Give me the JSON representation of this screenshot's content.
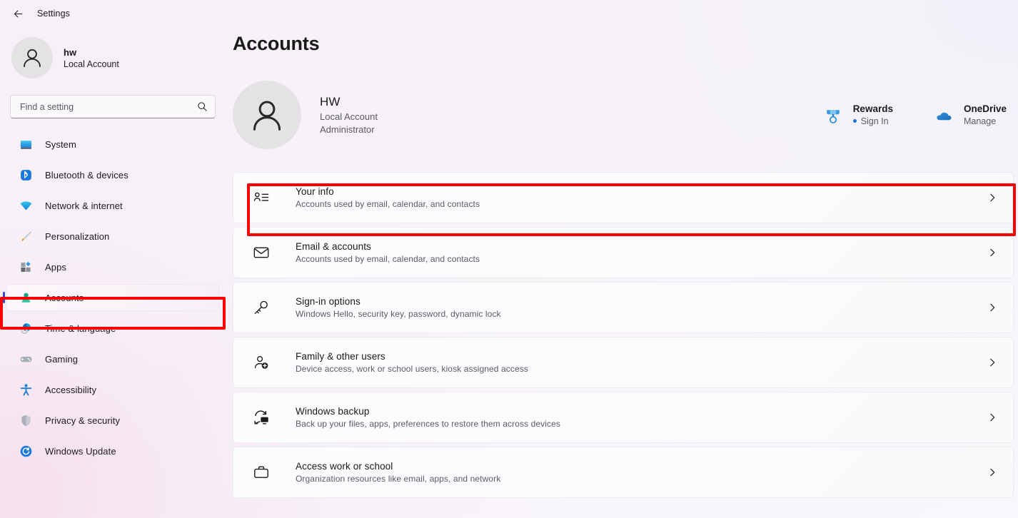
{
  "window": {
    "back_label": "back-arrow",
    "title": "Settings"
  },
  "sidebar": {
    "account": {
      "name": "hw",
      "type": "Local Account",
      "avatar_icon": "person-icon"
    },
    "search": {
      "placeholder": "Find a setting",
      "value": "",
      "icon": "search-icon"
    },
    "items": [
      {
        "label": "System",
        "icon": "monitor-icon",
        "selected": false
      },
      {
        "label": "Bluetooth & devices",
        "icon": "bluetooth-icon",
        "selected": false
      },
      {
        "label": "Network & internet",
        "icon": "wifi-icon",
        "selected": false
      },
      {
        "label": "Personalization",
        "icon": "paintbrush-icon",
        "selected": false
      },
      {
        "label": "Apps",
        "icon": "apps-icon",
        "selected": false
      },
      {
        "label": "Accounts",
        "icon": "account-person-icon",
        "selected": true
      },
      {
        "label": "Time & language",
        "icon": "clock-globe-icon",
        "selected": false
      },
      {
        "label": "Gaming",
        "icon": "gamepad-icon",
        "selected": false
      },
      {
        "label": "Accessibility",
        "icon": "accessibility-person-icon",
        "selected": false
      },
      {
        "label": "Privacy & security",
        "icon": "shield-icon",
        "selected": false
      },
      {
        "label": "Windows Update",
        "icon": "update-refresh-icon",
        "selected": false
      }
    ]
  },
  "main": {
    "page_title": "Accounts",
    "profile": {
      "avatar_icon": "person-icon",
      "name": "HW",
      "account_type": "Local Account",
      "role": "Administrator"
    },
    "services": [
      {
        "title": "Rewards",
        "subtitle": "Sign In",
        "icon": "rewards-medal-icon",
        "has_dot": true
      },
      {
        "title": "OneDrive",
        "subtitle": "Manage",
        "icon": "onedrive-cloud-icon",
        "has_dot": false
      }
    ],
    "cards": [
      {
        "title": "Your info",
        "subtitle": "Accounts used by email, calendar, and contacts",
        "icon": "your-info-icon",
        "chevron": "chevron-right-icon",
        "highlighted": true
      },
      {
        "title": "Email & accounts",
        "subtitle": "Accounts used by email, calendar, and contacts",
        "icon": "envelope-icon",
        "chevron": "chevron-right-icon",
        "highlighted": false
      },
      {
        "title": "Sign-in options",
        "subtitle": "Windows Hello, security key, password, dynamic lock",
        "icon": "key-icon",
        "chevron": "chevron-right-icon",
        "highlighted": false
      },
      {
        "title": "Family & other users",
        "subtitle": "Device access, work or school users, kiosk assigned access",
        "icon": "person-add-icon",
        "chevron": "chevron-right-icon",
        "highlighted": false
      },
      {
        "title": "Windows backup",
        "subtitle": "Back up your files, apps, preferences to restore them across devices",
        "icon": "backup-sync-icon",
        "chevron": "chevron-right-icon",
        "highlighted": false
      },
      {
        "title": "Access work or school",
        "subtitle": "Organization resources like email, apps, and network",
        "icon": "briefcase-icon",
        "chevron": "chevron-right-icon",
        "highlighted": false
      }
    ]
  },
  "annotations": {
    "highlight_color": "#fa0000",
    "targets": [
      "sidebar-item-accounts",
      "settings-card-your-info"
    ]
  }
}
